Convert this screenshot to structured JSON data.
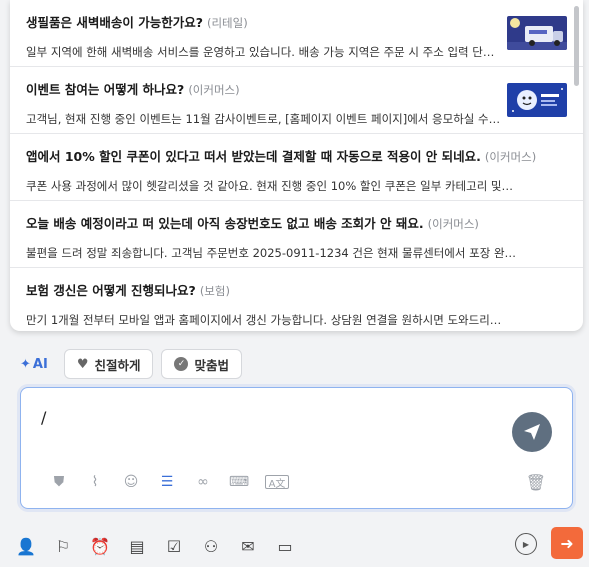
{
  "faq": [
    {
      "question": "생필품은 새벽배송이 가능한가요?",
      "category": "(리테일)",
      "answer": "일부 지역에 한해 새벽배송 서비스를 운영하고 있습니다. 배송 가능 지역은 주문 시 주소 입력 단계…",
      "thumb": "truck"
    },
    {
      "question": "이벤트 참여는 어떻게 하나요?",
      "category": "(이커머스)",
      "answer": "고객님, 현재 진행 중인 이벤트는 11월 감사이벤트로, [홈페이지 이벤트 페이지]에서 응모하실 수 …",
      "thumb": "event"
    },
    {
      "question": "앱에서 10% 할인 쿠폰이 있다고 떠서 받았는데 결제할 때 자동으로 적용이 안 되네요.",
      "category": "(이커머스)",
      "answer": "쿠폰 사용 과정에서 많이 헷갈리셨을 것 같아요. 현재 진행 중인 10% 할인 쿠폰은 일부 카테고리 및…",
      "thumb": ""
    },
    {
      "question": "오늘 배송 예정이라고 떠 있는데 아직 송장번호도 없고 배송 조회가 안 돼요.",
      "category": "(이커머스)",
      "answer": "불편을 드려 정말 죄송합니다. 고객님 주문번호 2025-0911-1234 건은 현재 물류센터에서 포장 완…",
      "thumb": ""
    },
    {
      "question": "보험 갱신은 어떻게 진행되나요?",
      "category": "(보험)",
      "answer": "만기 1개월 전부터 모바일 앱과 홈페이지에서 갱신 가능합니다. 상담원 연결을 원하시면 도와드리…",
      "thumb": ""
    }
  ],
  "toolbar": {
    "ai_label": "AI",
    "chip1_label": "친절하게",
    "chip2_label": "맞춤법"
  },
  "composer": {
    "text": "/"
  },
  "icons": {
    "composer_tools": [
      "shield-icon",
      "paperclip-icon",
      "emoji-icon",
      "list-icon",
      "link-icon",
      "keyboard-icon",
      "translate-icon"
    ],
    "bottom_tools": [
      "user-check-icon",
      "flag-icon",
      "alarm-icon",
      "document-icon",
      "clipboard-check-icon",
      "people-icon",
      "mail-icon",
      "ticket-icon"
    ]
  },
  "colors": {
    "accent": "#3b6fd8",
    "exit_button": "#f36a3b",
    "send_button": "#5f6f80"
  }
}
